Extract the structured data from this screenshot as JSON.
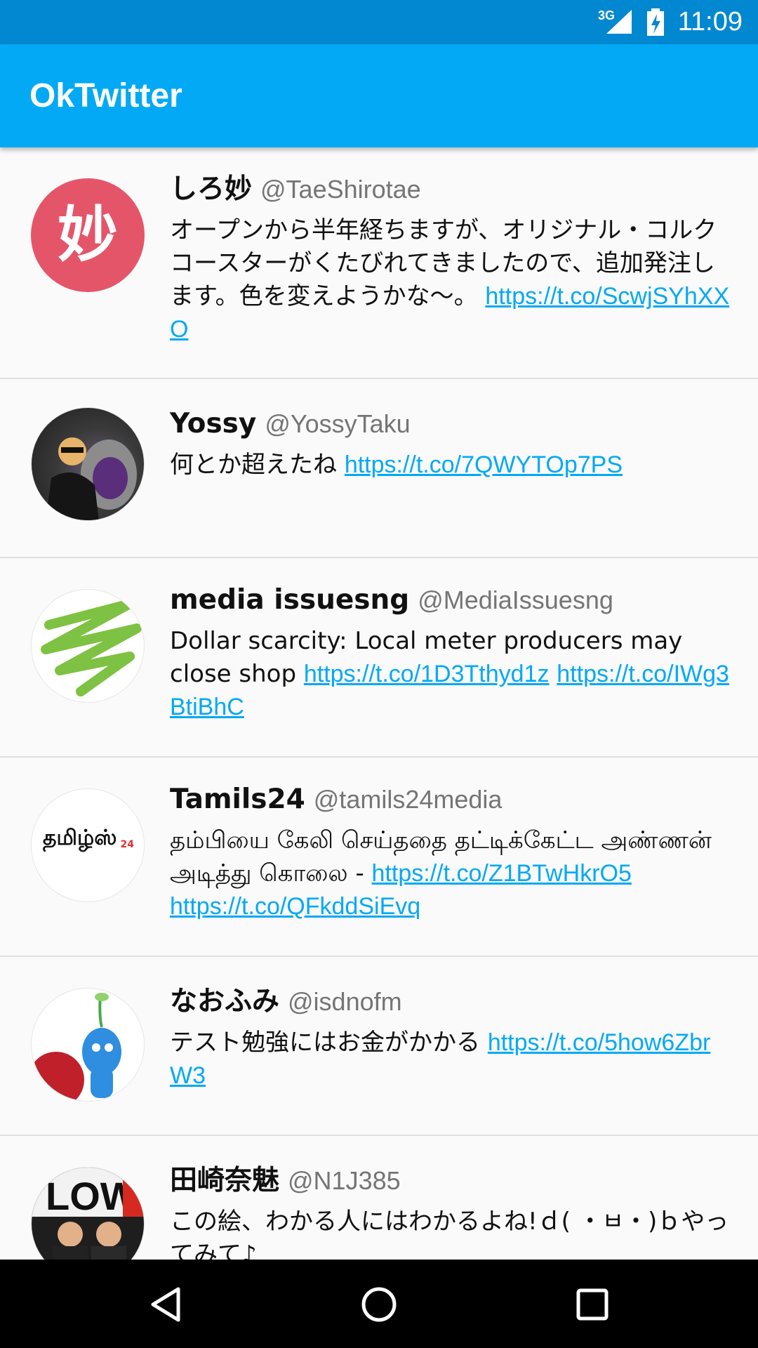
{
  "status_bar": {
    "network": "3G",
    "time": "11:09"
  },
  "app_bar": {
    "title": "OkTwitter"
  },
  "tweets": [
    {
      "name": "しろ妙",
      "handle": "@TaeShirotae",
      "text": "オープンから半年経ちますが、オリジナル・コルクコースターがくたびれてきましたので、追加発注します。色を変えようかな〜。",
      "links": [
        "https://t.co/ScwjSYhXXO"
      ],
      "avatar_text": "妙"
    },
    {
      "name": "Yossy",
      "handle": "@YossyTaku",
      "text": "何とか超えたね",
      "links": [
        "https://t.co/7QWYTOp7PS"
      ]
    },
    {
      "name": "media issuesng",
      "handle": "@MediaIssuesng",
      "text": "Dollar scarcity: Local meter producers may close shop",
      "links": [
        "https://t.co/1D3Tthyd1z",
        "https://t.co/IWg3BtiBhC"
      ]
    },
    {
      "name": "Tamils24",
      "handle": "@tamils24media",
      "text": "தம்பியை கேலி செய்ததை தட்டிக்கேட்ட அண்ணன் அடித்து கொலை -",
      "links": [
        "https://t.co/Z1BTwHkrO5",
        "https://t.co/QFkddSiEvq"
      ],
      "avatar_text": "தமிழ்ஸ்",
      "avatar_sub": "24"
    },
    {
      "name": "なおふみ",
      "handle": "@isdnofm",
      "text": "テスト勉強にはお金がかかる",
      "links": [
        "https://t.co/5how6ZbrW3"
      ]
    },
    {
      "name": "田崎奈魅",
      "handle": "@N1J385",
      "text": "この絵、わかる人にはわかるよね!ｄ( ・ㅂ・)ｂやってみて♪",
      "links": []
    }
  ],
  "nav_bar": {
    "back": "back-icon",
    "home": "home-icon",
    "recents": "recents-icon"
  }
}
